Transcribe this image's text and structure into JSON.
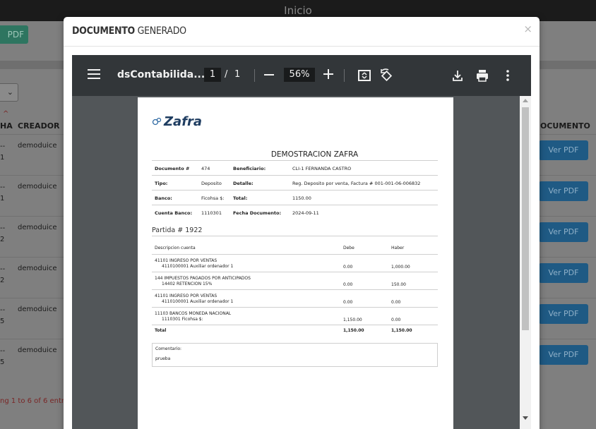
{
  "background": {
    "app_title": "Inicio",
    "pdf_button": "PDF",
    "select_value": "",
    "columns": {
      "fecha": "HA",
      "creador": "CREADOR",
      "documento": "OCUMENTO"
    },
    "rows": [
      {
        "date_line1": "--",
        "date_line2": "1",
        "creador": "demoduice",
        "action": "Ver PDF"
      },
      {
        "date_line1": "--",
        "date_line2": "1",
        "creador": "demoduice",
        "action": "Ver PDF"
      },
      {
        "date_line1": "--",
        "date_line2": "2",
        "creador": "demoduice",
        "action": "Ver PDF"
      },
      {
        "date_line1": "--",
        "date_line2": "2",
        "creador": "demoduice",
        "action": "Ver PDF"
      },
      {
        "date_line1": "--",
        "date_line2": "5",
        "creador": "demoduice",
        "action": "Ver PDF"
      },
      {
        "date_line1": "--",
        "date_line2": "5",
        "creador": "demoduice",
        "action": "Ver PDF"
      }
    ],
    "entries_info": "ng 1 to 6 of 6 entries"
  },
  "modal": {
    "title_bold": "DOCUMENTO",
    "title_rest": " GENERADO",
    "close": "×"
  },
  "viewer": {
    "file_name": "dsContabilida...",
    "page_current": "1",
    "page_separator": "/",
    "page_total": "1",
    "zoom": "56%",
    "icons": [
      "menu-icon",
      "zoom-out-icon",
      "zoom-in-icon",
      "fit-page-icon",
      "rotate-icon",
      "download-icon",
      "print-icon",
      "more-icon"
    ]
  },
  "document": {
    "logo": "Zafra",
    "title": "DEMOSTRACION ZAFRA",
    "fields": {
      "documento_label": "Documento #",
      "documento_value": "474",
      "beneficiario_label": "Beneficiario:",
      "beneficiario_value": "CLI-1   FERNANDA CASTRO",
      "tipo_label": "Tipo:",
      "tipo_value": "Deposito",
      "detalle_label": "Detalle:",
      "detalle_value": "Reg. Deposito por venta, Factura # 001-001-06-006832",
      "banco_label": "Banco:",
      "banco_value": "Ficohsa $:",
      "total_label": "Total:",
      "total_value": "1150.00",
      "cuenta_label": "Cuenta Banco:",
      "cuenta_value": "1110301",
      "fecha_label": "Fecha Documento:",
      "fecha_value": "2024-09-11"
    },
    "partida": "Partida # 1922",
    "columns": {
      "descripcion": "Descripcion cuenta",
      "debe": "Debe",
      "haber": "Haber"
    },
    "rows": [
      {
        "cuenta": "41101 INGRESO POR VENTAS",
        "auxiliar": "4110100001 Auxiliar ordenador 1",
        "debe": "0.00",
        "haber": "1,000.00"
      },
      {
        "cuenta": "144 IMPUESTOS PAGADOS POR ANTICIPADOS",
        "auxiliar": "14402 RETENCION 15%",
        "debe": "0.00",
        "haber": "150.00"
      },
      {
        "cuenta": "41101 INGRESO POR VENTAS",
        "auxiliar": "4110100001 Auxiliar ordenador 1",
        "debe": "0.00",
        "haber": "0.00"
      },
      {
        "cuenta": "11103 BANCOS MONEDA NACIONAL",
        "auxiliar": "1110301 Ficohsa $:",
        "debe": "1,150.00",
        "haber": "0.00"
      }
    ],
    "total": {
      "label": "Total",
      "debe": "1,150.00",
      "haber": "1,150.00"
    },
    "comentario_label": "Comentario:",
    "comentario_value": "prueba"
  },
  "colors": {
    "toolbar": "#323639",
    "viewer_bg": "#525659",
    "brand": "#1f3d61",
    "ver_pdf_button": "#1f5a84",
    "pdf_button": "#2e7560"
  }
}
